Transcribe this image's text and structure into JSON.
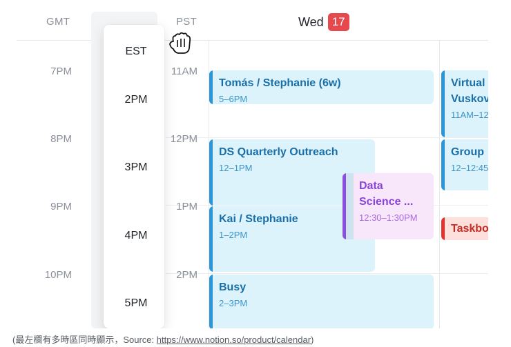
{
  "timezones": {
    "left": "GMT",
    "dragging": "EST",
    "right": "PST"
  },
  "day": {
    "name": "Wed",
    "date": "17"
  },
  "gmt_times": [
    "7PM",
    "8PM",
    "9PM",
    "10PM"
  ],
  "pst_times": [
    "11AM",
    "12PM",
    "1PM",
    "2PM"
  ],
  "est_times": [
    "2PM",
    "3PM",
    "4PM",
    "5PM"
  ],
  "events": [
    {
      "title": "Tomás / Stephanie (6w)",
      "time": "5–6PM",
      "color": "blue"
    },
    {
      "title": "DS Quarterly Outreach",
      "time": "12–1PM",
      "color": "blue"
    },
    {
      "title": "Kai / Stephanie",
      "time": "1–2PM",
      "color": "blue"
    },
    {
      "title": "Busy",
      "time": "2–3PM",
      "color": "blue"
    },
    {
      "title": "Data\nScience ...",
      "time": "12:30–1:30PM",
      "color": "purple"
    },
    {
      "title": "Virtual\nVuskov",
      "time": "11AM–12",
      "color": "blue"
    },
    {
      "title": "Group",
      "time": "12–12:45",
      "color": "blue"
    },
    {
      "title": "Taskbo",
      "time": "",
      "color": "red"
    }
  ],
  "caption": {
    "prefix": "(最左欄有多時區同時顯示，Source: ",
    "url": "https://www.notion.so/product/calendar",
    "suffix": ")"
  },
  "colors": {
    "accent_red": "#e5484d",
    "event_blue": "#2b96d8",
    "event_purple": "#8c4fe0",
    "event_red": "#e5322d"
  },
  "icons": {
    "cursor": "grab-hand-icon"
  }
}
